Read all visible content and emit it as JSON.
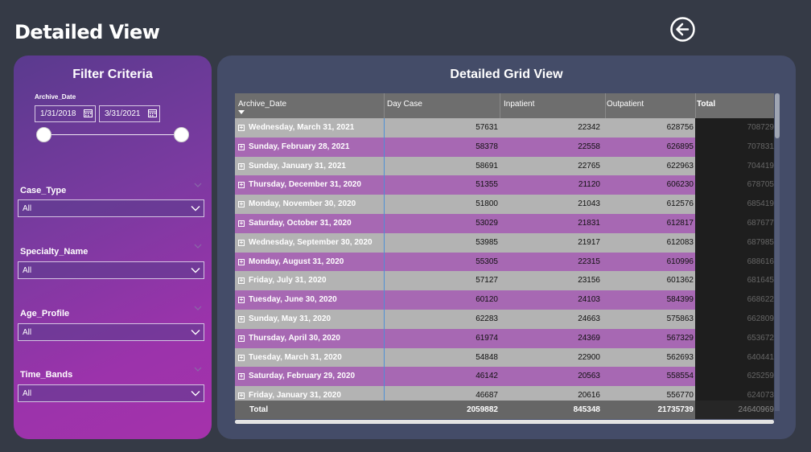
{
  "page": {
    "title": "Detailed View"
  },
  "header": {
    "back_icon": "arrow-left-circle-icon"
  },
  "filters": {
    "title": "Filter Criteria",
    "archive_date": {
      "label": "Archive_Date",
      "start": "1/31/2018",
      "end": "3/31/2021"
    },
    "slicers": [
      {
        "label": "Case_Type",
        "value": "All"
      },
      {
        "label": "Specialty_Name",
        "value": "All"
      },
      {
        "label": "Age_Profile",
        "value": "All"
      },
      {
        "label": "Time_Bands",
        "value": "All"
      }
    ]
  },
  "grid": {
    "title": "Detailed Grid View",
    "columns": [
      "Archive_Date",
      "Day Case",
      "Inpatient",
      "Outpatient",
      "Total"
    ],
    "rows": [
      {
        "date": "Wednesday, March 31, 2021",
        "day_case": "57631",
        "inpatient": "22342",
        "outpatient": "628756",
        "total": "708729"
      },
      {
        "date": "Sunday, February 28, 2021",
        "day_case": "58378",
        "inpatient": "22558",
        "outpatient": "626895",
        "total": "707831"
      },
      {
        "date": "Sunday, January 31, 2021",
        "day_case": "58691",
        "inpatient": "22765",
        "outpatient": "622963",
        "total": "704419"
      },
      {
        "date": "Thursday, December 31, 2020",
        "day_case": "51355",
        "inpatient": "21120",
        "outpatient": "606230",
        "total": "678705"
      },
      {
        "date": "Monday, November 30, 2020",
        "day_case": "51800",
        "inpatient": "21043",
        "outpatient": "612576",
        "total": "685419"
      },
      {
        "date": "Saturday, October 31, 2020",
        "day_case": "53029",
        "inpatient": "21831",
        "outpatient": "612817",
        "total": "687677"
      },
      {
        "date": "Wednesday, September 30, 2020",
        "day_case": "53985",
        "inpatient": "21917",
        "outpatient": "612083",
        "total": "687985"
      },
      {
        "date": "Monday, August 31, 2020",
        "day_case": "55305",
        "inpatient": "22315",
        "outpatient": "610996",
        "total": "688616"
      },
      {
        "date": "Friday, July 31, 2020",
        "day_case": "57127",
        "inpatient": "23156",
        "outpatient": "601362",
        "total": "681645"
      },
      {
        "date": "Tuesday, June 30, 2020",
        "day_case": "60120",
        "inpatient": "24103",
        "outpatient": "584399",
        "total": "668622"
      },
      {
        "date": "Sunday, May 31, 2020",
        "day_case": "62283",
        "inpatient": "24663",
        "outpatient": "575863",
        "total": "662809"
      },
      {
        "date": "Thursday, April 30, 2020",
        "day_case": "61974",
        "inpatient": "24369",
        "outpatient": "567329",
        "total": "653672"
      },
      {
        "date": "Tuesday, March 31, 2020",
        "day_case": "54848",
        "inpatient": "22900",
        "outpatient": "562693",
        "total": "640441"
      },
      {
        "date": "Saturday, February 29, 2020",
        "day_case": "46142",
        "inpatient": "20563",
        "outpatient": "558554",
        "total": "625259"
      },
      {
        "date": "Friday, January 31, 2020",
        "day_case": "46687",
        "inpatient": "20616",
        "outpatient": "556770",
        "total": "624073"
      }
    ],
    "totals": {
      "label": "Total",
      "day_case": "2059882",
      "inpatient": "845348",
      "outpatient": "21735739",
      "total": "24640969"
    }
  }
}
